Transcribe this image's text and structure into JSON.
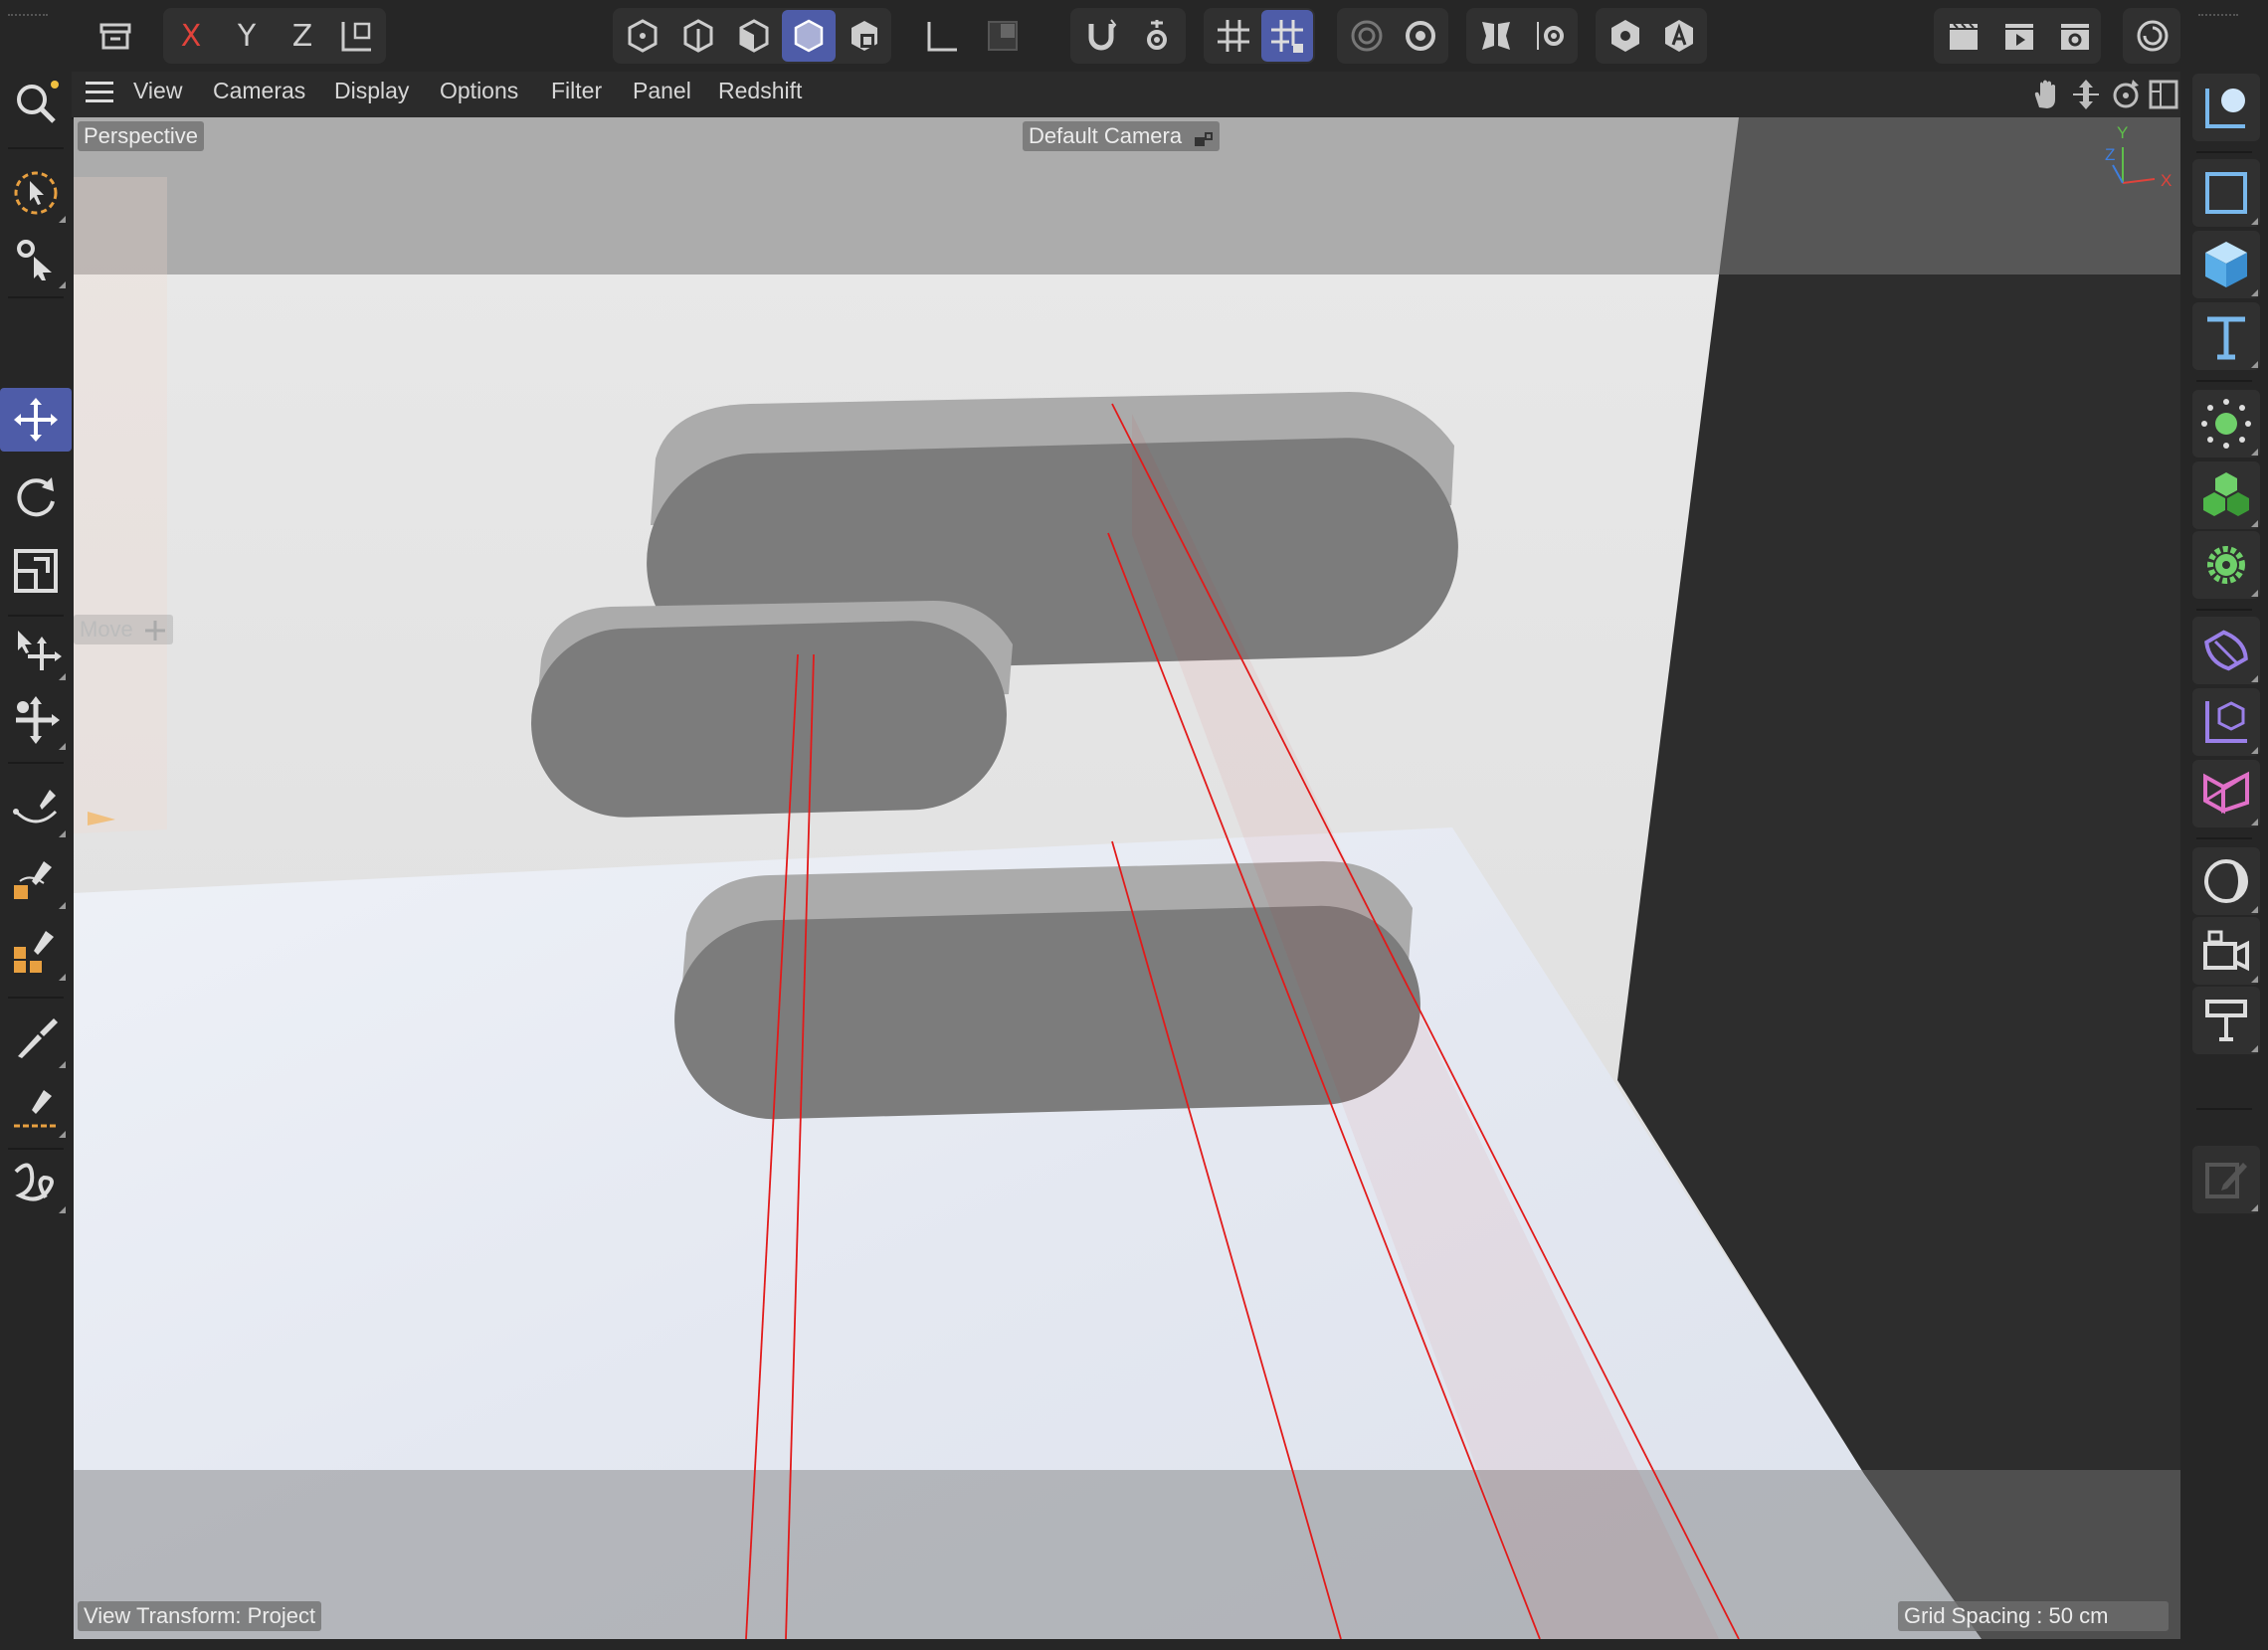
{
  "top_toolbar": {
    "axis_x": "X",
    "axis_y": "Y",
    "axis_z": "Z"
  },
  "viewport_menu": {
    "items": [
      "View",
      "Cameras",
      "Display",
      "Options",
      "Filter",
      "Panel",
      "Redshift"
    ]
  },
  "viewport": {
    "view_name": "Perspective",
    "camera_name": "Default Camera",
    "active_tool": "Move",
    "view_transform": "View Transform: Project",
    "grid_spacing": "Grid Spacing : 50 cm",
    "axis_gizmo": {
      "x": "X",
      "y": "Y",
      "z": "Z"
    }
  },
  "colors": {
    "accent": "#4e5ca8",
    "axis_x": "#e0433b",
    "axis_y": "#5fbf4a",
    "axis_z": "#3f7fe0",
    "guide_line": "#e21a1a",
    "object_fill": "#7b7b7b",
    "object_top": "#a8a8a8"
  },
  "icons": {
    "left": [
      "search-icon",
      "live-selection-icon",
      "settings-select-icon",
      "move-icon",
      "rotate-icon",
      "scale-icon",
      "move-tool-alt-icon",
      "multi-move-icon",
      "spline-pen-icon",
      "spline-pen-box-icon",
      "spline-cubes-icon",
      "brush-icon",
      "spline-smooth-icon",
      "sketch-icon"
    ],
    "right": [
      "camera-object-icon",
      "rectangle-spline-icon",
      "cube-icon",
      "text-icon",
      "null-light-icon",
      "cloner-icon",
      "gear-generator-icon",
      "deformer-icon",
      "coordinate-cube-icon",
      "field-icon",
      "environment-icon",
      "camera-icon",
      "floor-icon",
      "edit-icon"
    ]
  }
}
